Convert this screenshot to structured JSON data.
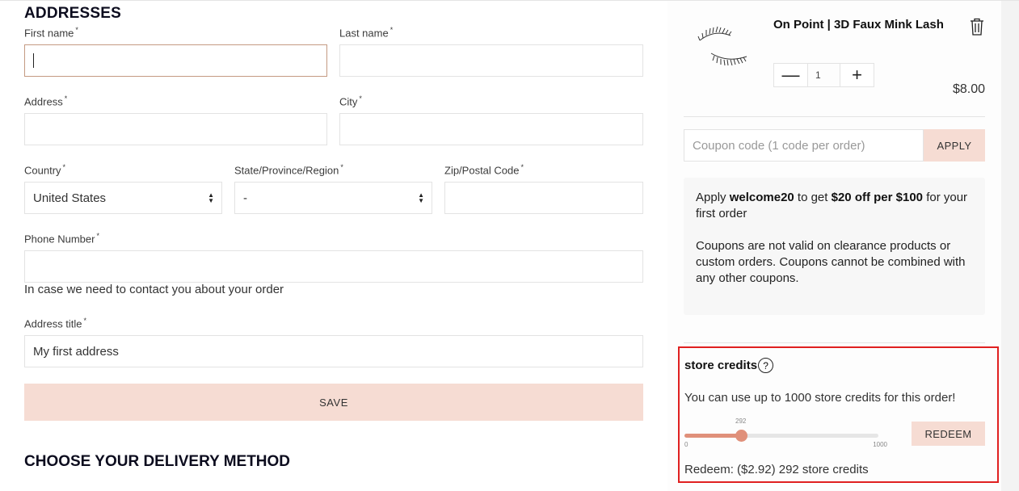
{
  "addresses": {
    "title": "ADDRESSES",
    "fields": {
      "first_name": {
        "label": "First name",
        "required": "*",
        "value": ""
      },
      "last_name": {
        "label": "Last name",
        "required": "*",
        "value": ""
      },
      "address": {
        "label": "Address",
        "required": "*",
        "value": ""
      },
      "city": {
        "label": "City",
        "required": "*",
        "value": ""
      },
      "country": {
        "label": "Country",
        "required": "*",
        "value": "United States"
      },
      "state": {
        "label": "State/Province/Region",
        "required": "*",
        "value": "-"
      },
      "zip": {
        "label": "Zip/Postal Code",
        "required": "*",
        "value": ""
      },
      "phone": {
        "label": "Phone Number",
        "required": "*",
        "value": "",
        "helper": "In case we need to contact you about your order"
      },
      "address_title": {
        "label": "Address title",
        "required": "*",
        "value": "My first address"
      }
    },
    "save_label": "SAVE"
  },
  "delivery": {
    "title": "CHOOSE YOUR DELIVERY METHOD"
  },
  "cart": {
    "item": {
      "name": "On Point | 3D Faux Mink Lash",
      "quantity": "1",
      "price": "$8.00",
      "minus_label": "—",
      "plus_label": "+"
    },
    "coupon": {
      "placeholder": "Coupon code (1 code per order)",
      "apply_label": "APPLY"
    },
    "promo": {
      "pre": "Apply ",
      "code": "welcome20",
      "mid": " to get ",
      "offer": "$20 off per $100",
      "post": " for your first order",
      "disclaimer": "Coupons are not valid on clearance products or custom orders. Coupons cannot be combined with any other coupons."
    },
    "store_credits": {
      "title": "store credits",
      "help_icon": "?",
      "info": "You can use up to 1000 store credits for this order!",
      "slider": {
        "min": 0,
        "max": 1000,
        "value": 292,
        "min_label": "0",
        "max_label": "1000",
        "value_label": "292"
      },
      "redeem_label": "REDEEM",
      "summary": "Redeem: ($2.92) 292 store credits"
    }
  },
  "colors": {
    "accent_pink": "#f6dcd3",
    "slider_fill": "#e0907a",
    "highlight_border": "#e02020",
    "focus_border": "#c49a82"
  }
}
